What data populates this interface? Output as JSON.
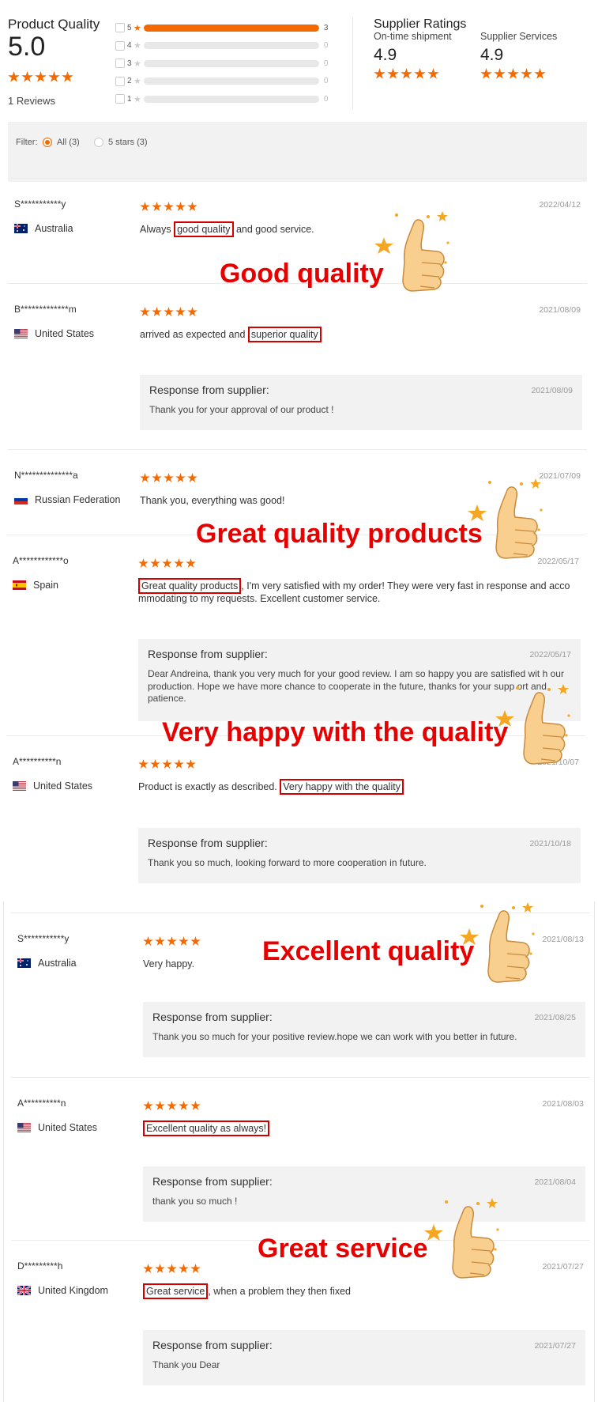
{
  "summary": {
    "product_quality_title": "Product Quality",
    "product_quality_score": "5.0",
    "reviews_count_label": "1 Reviews",
    "distribution": [
      {
        "stars": "5",
        "count": "3",
        "fraction": 1.0
      },
      {
        "stars": "4",
        "count": "0",
        "fraction": 0
      },
      {
        "stars": "3",
        "count": "0",
        "fraction": 0
      },
      {
        "stars": "2",
        "count": "0",
        "fraction": 0
      },
      {
        "stars": "1",
        "count": "0",
        "fraction": 0
      }
    ],
    "supplier_ratings_title": "Supplier Ratings",
    "ontime_label": "On-time shipment",
    "ontime_score": "4.9",
    "services_label": "Supplier Services",
    "services_score": "4.9"
  },
  "filter": {
    "label": "Filter:",
    "options": [
      "All (3)",
      "5 stars (3)"
    ],
    "selected": "All (3)"
  },
  "response_title": "Response from supplier:",
  "reviews": [
    {
      "user": "S***********y",
      "country": "Australia",
      "flag": "australia-flag-icon",
      "date": "2022/04/12",
      "pre": "Always ",
      "hl": "good quality",
      "post": " and good service."
    },
    {
      "user": "B*************m",
      "country": "United States",
      "flag": "us-flag-icon",
      "date": "2021/08/09",
      "pre": "arrived as expected and ",
      "hl": "superior quality",
      "post": "",
      "response": {
        "date": "2021/08/09",
        "text": "Thank you for your approval of our product !"
      }
    },
    {
      "user": "N**************a",
      "country": "Russian Federation",
      "flag": "russia-flag-icon",
      "date": "2021/07/09",
      "pre": "Thank you, everything was good!",
      "hl": "",
      "post": ""
    },
    {
      "user": "A************o",
      "country": "Spain",
      "flag": "spain-flag-icon",
      "date": "2022/05/17",
      "pre": "",
      "hl": "Great quality products",
      "post": ", I'm very satisfied with my order! They were very fast in response and acco mmodating to my requests. Excellent customer service.",
      "response": {
        "date": "2022/05/17",
        "text": "Dear Andreina, thank you very much for your good review. I am so happy you are satisfied wit h our production. Hope we have more chance to cooperate in the future, thanks for your supp ort and patience."
      }
    },
    {
      "user": "A**********n",
      "country": "United States",
      "flag": "us-flag-icon",
      "date": "2021/10/07",
      "pre": "Product is exactly as described. ",
      "hl": "Very happy with the quality",
      "post": "",
      "response": {
        "date": "2021/10/18",
        "text": "Thank you so much, looking forward to more cooperation in future."
      }
    },
    {
      "user": "S***********y",
      "country": "Australia",
      "flag": "australia-flag-icon",
      "date": "2021/08/13",
      "pre": "Very happy.",
      "hl": "",
      "post": "",
      "response": {
        "date": "2021/08/25",
        "text": "Thank you so much for your positive review.hope we can work with you better in future."
      }
    },
    {
      "user": "A**********n",
      "country": "United States",
      "flag": "us-flag-icon",
      "date": "2021/08/03",
      "pre": "",
      "hl": "Excellent quality as always!",
      "post": "",
      "response": {
        "date": "2021/08/04",
        "text": "thank you so much !"
      }
    },
    {
      "user": "D*********h",
      "country": "United Kingdom",
      "flag": "uk-flag-icon",
      "date": "2021/07/27",
      "pre": "",
      "hl": "Great service",
      "post": ", when a problem they then fixed",
      "response": {
        "date": "2021/07/27",
        "text": "Thank you Dear"
      }
    }
  ],
  "captions": [
    "Good quality",
    "Great quality products",
    "Very happy with the quality",
    "Excellent quality",
    "Great service"
  ],
  "colors": {
    "accent": "#f56a00",
    "highlight": "#d40000",
    "caption": "#e60000"
  }
}
